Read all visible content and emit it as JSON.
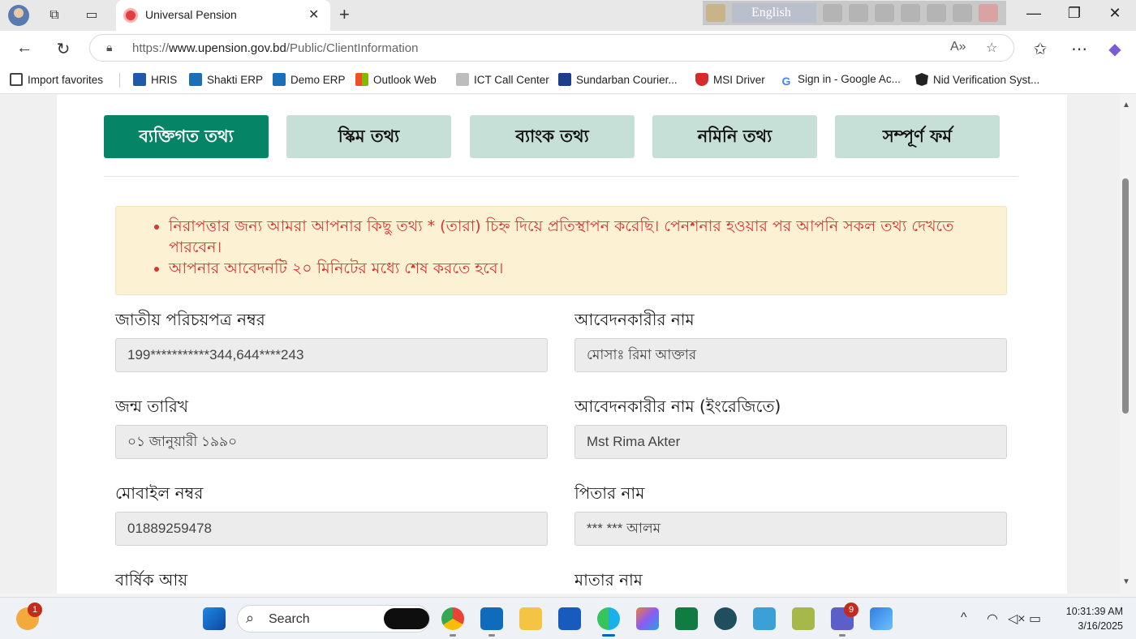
{
  "browser": {
    "tab_title": "Universal Pension",
    "url_prefix": "https://",
    "url_host": "www.upension.gov.bd",
    "url_path": "/Public/ClientInformation",
    "translator_language": "English"
  },
  "bookmarks": [
    {
      "label": "Import favorites",
      "color": "#444444"
    },
    {
      "label": "HRIS",
      "color": "#1e5aa8"
    },
    {
      "label": "Shakti ERP",
      "color": "#1a6fb8"
    },
    {
      "label": "Demo ERP",
      "color": "#1a6fb8"
    },
    {
      "label": "Outlook Web",
      "color": "#f25022"
    },
    {
      "label": "ICT Call Center",
      "color": "#9a9a9a"
    },
    {
      "label": "Sundarban Courier...",
      "color": "#1e3d8a"
    },
    {
      "label": "MSI Driver",
      "color": "#d62b2b"
    },
    {
      "label": "Sign in - Google Ac...",
      "color": "#4285f4"
    },
    {
      "label": "Nid Verification Syst...",
      "color": "#222222"
    }
  ],
  "steps": [
    {
      "label": "ব্যক্তিগত তথ্য",
      "active": true
    },
    {
      "label": "স্কিম তথ্য",
      "active": false
    },
    {
      "label": "ব্যাংক তথ্য",
      "active": false
    },
    {
      "label": "নমিনি তথ্য",
      "active": false
    },
    {
      "label": "সম্পূর্ণ ফর্ম",
      "active": false
    }
  ],
  "alert": {
    "items": [
      "নিরাপত্তার জন্য আমরা আপনার কিছু তথ্য * (তারা) চিহ্ন দিয়ে প্রতিস্থাপন করেছি। পেনশনার হওয়ার পর আপনি সকল তথ্য দেখতে পারবেন।",
      "আপনার আবেদনটি ২০ মিনিটের মধ্যে শেষ করতে হবে।"
    ]
  },
  "fields": {
    "nid": {
      "label": "জাতীয় পরিচয়পত্র নম্বর",
      "value": "199***********344,644****243"
    },
    "applicant_name": {
      "label": "আবেদনকারীর নাম",
      "value": "মোসাঃ রিমা আক্তার"
    },
    "dob": {
      "label": "জন্ম তারিখ",
      "value": "০১ জানুয়ারী ১৯৯০"
    },
    "applicant_name_en": {
      "label": "আবেদনকারীর নাম (ইংরেজিতে)",
      "value": "Mst Rima Akter"
    },
    "mobile": {
      "label": "মোবাইল নম্বর",
      "value": "01889259478"
    },
    "father_name": {
      "label": "পিতার নাম",
      "value": "*** *** আলম"
    },
    "annual_income": {
      "label": "বার্ষিক আয়"
    },
    "mother_name": {
      "label": "মাতার নাম"
    }
  },
  "taskbar": {
    "weather_badge": "1",
    "search_label": "Search",
    "teams_badge": "9",
    "time": "10:31:39 AM",
    "date": "3/16/2025"
  },
  "colors": {
    "step_active": "#058466",
    "step_inactive": "#c6e0d7",
    "alert_bg": "#fdf1d3",
    "alert_text": "#d53737"
  }
}
